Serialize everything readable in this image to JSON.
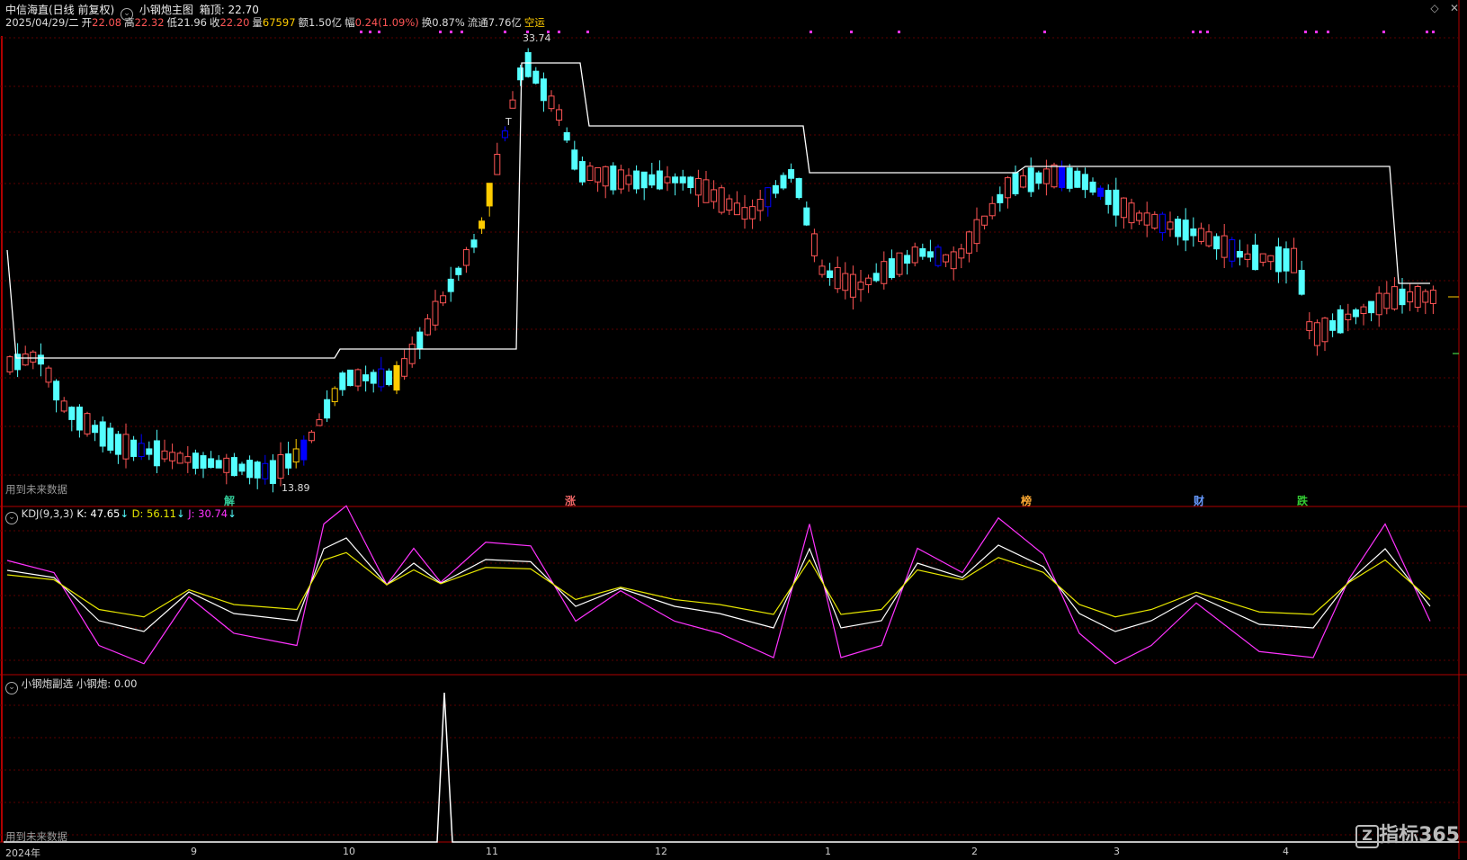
{
  "header": {
    "stock_name": "中信海直(日线 前复权)",
    "indicator_icon": "circle-chevron-icon",
    "main_indicator": "小钢炮主图",
    "box_top_label": "箱顶: 22.70",
    "date": "2025/04/29/二",
    "open_label": "开",
    "open": "22.08",
    "high_label": "高",
    "high": "22.32",
    "low_label": "低",
    "low": "21.96",
    "close_label": "收",
    "close": "22.20",
    "vol_label": "量",
    "vol": "67597",
    "amount": "额1.50亿",
    "change_label": "幅",
    "change": "0.24(1.09%)",
    "turnover": "换0.87%",
    "float": "流通7.76亿",
    "status": "空运"
  },
  "main_panel": {
    "future_data": "用到未来数据",
    "high_mark": "33.74",
    "low_mark": "13.89",
    "t_mark": "T",
    "signals": [
      {
        "label": "解",
        "color": "#3c9"
      },
      {
        "label": "涨",
        "color": "#e66"
      },
      {
        "label": "榜",
        "color": "#fa3"
      },
      {
        "label": "财",
        "color": "#69f"
      },
      {
        "label": "跌",
        "color": "#3c3"
      }
    ]
  },
  "kdj_panel": {
    "name": "KDJ(9,3,3)",
    "k_label": "K: 47.65",
    "d_label": "D: 56.11",
    "j_label": "J: 30.74",
    "arrow": "↓"
  },
  "sub_panel": {
    "name": "小钢炮副选",
    "value_label": "小钢炮: 0.00",
    "future_data": "用到未来数据"
  },
  "axis": {
    "months": [
      "2024年",
      "9",
      "10",
      "11",
      "12",
      "1",
      "2",
      "3",
      "4"
    ]
  },
  "watermark": "指标365",
  "window": {
    "maximize_icon": "diamond-icon",
    "close_icon": "close-icon"
  },
  "colors": {
    "up": "#ff5555",
    "down": "#54ffff",
    "blue_body": "#0000ff",
    "yellow_body": "#ffcc00",
    "grid": "#5a0000",
    "panel_border": "#b00000",
    "box_line": "#ffffff",
    "k": "#ffffff",
    "d": "#e6e600",
    "j": "#ff33ff"
  }
}
